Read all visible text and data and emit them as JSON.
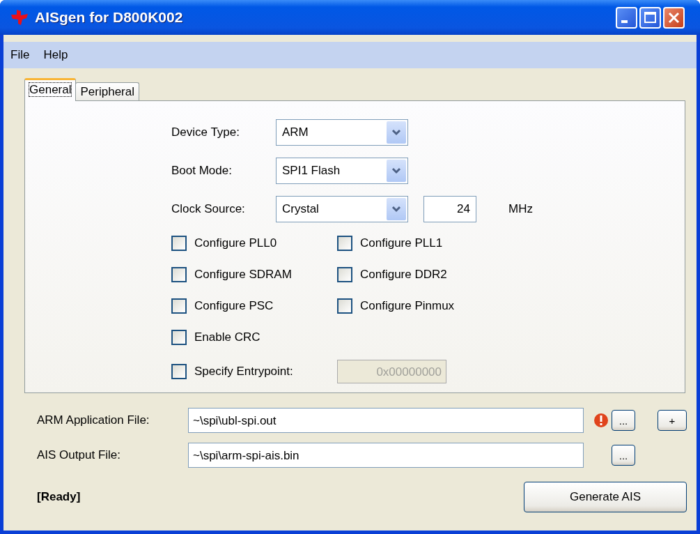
{
  "window": {
    "title": "AISgen for D800K002"
  },
  "menu": [
    "File",
    "Help"
  ],
  "tabs": [
    {
      "label": "General",
      "selected": true
    },
    {
      "label": "Peripheral",
      "selected": false
    }
  ],
  "general": {
    "dropdowns": [
      {
        "label": "Device Type:",
        "value": "ARM"
      },
      {
        "label": "Boot Mode:",
        "value": "SPI1 Flash"
      },
      {
        "label": "Clock Source:",
        "value": "Crystal",
        "frequency": "24",
        "unit": "MHz"
      }
    ],
    "checkboxes": [
      {
        "label": "Configure PLL0",
        "checked": false
      },
      {
        "label": "Configure PLL1",
        "checked": false
      },
      {
        "label": "Configure SDRAM",
        "checked": false
      },
      {
        "label": "Configure DDR2",
        "checked": false
      },
      {
        "label": "Configure PSC",
        "checked": false
      },
      {
        "label": "Configure Pinmux",
        "checked": false
      },
      {
        "label": "Enable CRC",
        "checked": false
      }
    ],
    "entrypoint": {
      "label": "Specify Entrypoint:",
      "checked": false,
      "value": "0x00000000",
      "disabled": true
    }
  },
  "files": [
    {
      "label": "ARM Application File:",
      "value": "~\\spi\\ubl-spi.out",
      "error": true,
      "browse": "...",
      "add": "+"
    },
    {
      "label": "AIS Output File:",
      "value": "~\\spi\\arm-spi-ais.bin",
      "error": false,
      "browse": "..."
    }
  ],
  "status": "[Ready]",
  "generate_button": "Generate AIS"
}
